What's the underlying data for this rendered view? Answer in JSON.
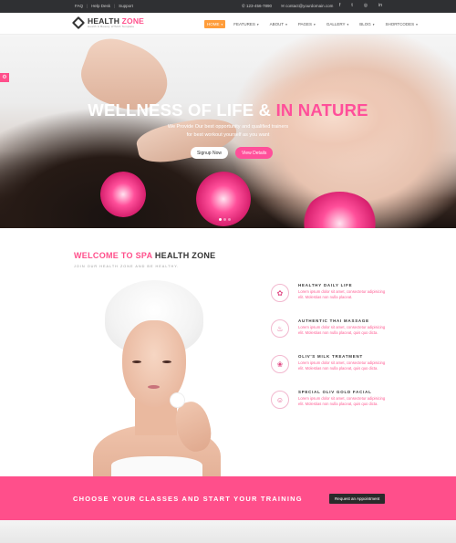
{
  "topbar": {
    "links": [
      "FAQ",
      "Help Desk",
      "Support"
    ],
    "phone": "123-456-7890",
    "email": "contact@yourdomain.com",
    "social": [
      "f-icon",
      "twitter-icon",
      "instagram-icon",
      "linkedin-icon"
    ]
  },
  "header": {
    "logo_main": "HEALTH",
    "logo_accent": "ZONE",
    "logo_sub": "Health & Beauty HTML5 Template",
    "nav": [
      "HOME",
      "FEATURES",
      "ABOUT",
      "PAGES",
      "GALLERY",
      "BLOG",
      "SHORTCODES"
    ]
  },
  "hero": {
    "title_white": "WELLNESS OF LIFE &",
    "title_pink": "IN NATURE",
    "subtitle_line1": "We Provide Our best opportunity and qualified trainers",
    "subtitle_line2": "for best workout yourself as you want",
    "btn_signup": "Signup Now",
    "btn_details": "View Details"
  },
  "welcome": {
    "title_pink": "WELCOME TO SPA",
    "title_dark": "HEALTH ZONE",
    "subtitle": "JOIN OUR HEALTH ZONE AND BE HEALTHY.",
    "features": [
      {
        "title": "HEALTHY DAILY LIFE",
        "desc": "Lorem ipsum dolor sit amet, consectetur adipisicing elit. Molestias non nulla placeat.",
        "icon": "flower-icon"
      },
      {
        "title": "AUTHENTIC THAI MASSAGE",
        "desc": "Lorem ipsum dolor sit amet, consectetur adipisicing elit. Molestias non nulla placeat, quis quo dicta.",
        "icon": "massage-icon"
      },
      {
        "title": "OLIV'S MILK TREATMENT",
        "desc": "Lorem ipsum dolor sit amet, consectetur adipisicing elit. Molestias non nulla placeat, quis quo dicta.",
        "icon": "spa-jar-icon"
      },
      {
        "title": "SPECIAL OLIV GOLD FACIAL",
        "desc": "Lorem ipsum dolor sit amet, consectetur adipisicing elit. Molestias non nulla placeat, quis quo dicta.",
        "icon": "face-icon"
      }
    ]
  },
  "cta": {
    "text": "CHOOSE YOUR CLASSES AND START YOUR TRAINING",
    "button": "Request an Appointment"
  },
  "colors": {
    "accent": "#ff4f8b",
    "nav_active": "#ff9d3b",
    "topbar": "#2f3033"
  }
}
